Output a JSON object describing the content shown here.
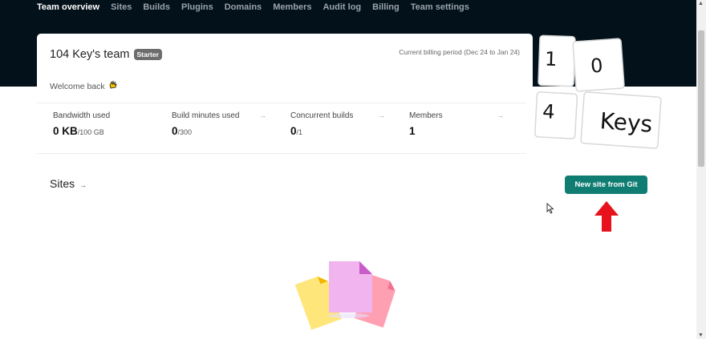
{
  "nav": {
    "items": [
      {
        "label": "Team overview",
        "active": true
      },
      {
        "label": "Sites",
        "active": false
      },
      {
        "label": "Builds",
        "active": false
      },
      {
        "label": "Plugins",
        "active": false
      },
      {
        "label": "Domains",
        "active": false
      },
      {
        "label": "Members",
        "active": false
      },
      {
        "label": "Audit log",
        "active": false
      },
      {
        "label": "Billing",
        "active": false
      },
      {
        "label": "Team settings",
        "active": false
      }
    ]
  },
  "team": {
    "name": "104 Key's team",
    "plan_badge": "Starter",
    "billing_period": "Current billing period (Dec 24 to Jan 24)",
    "welcome": "Welcome back",
    "welcome_icon": "waving-hand-icon"
  },
  "stats": [
    {
      "label": "Bandwidth used",
      "value": "0 KB",
      "limit": "/100 GB",
      "has_arrow": false
    },
    {
      "label": "Build minutes used",
      "value": "0",
      "limit": "/300",
      "has_arrow": true
    },
    {
      "label": "Concurrent builds",
      "value": "0",
      "limit": "/1",
      "has_arrow": true
    },
    {
      "label": "Members",
      "value": "1",
      "limit": "",
      "has_arrow": true
    }
  ],
  "stat_arrow": "→",
  "logo": {
    "keys": [
      "1",
      "0",
      "4",
      "Keys"
    ]
  },
  "sites": {
    "title": "Sites",
    "title_arrow": "→",
    "new_site_button": "New site from Git"
  },
  "colors": {
    "header_bg": "#03111a",
    "primary_button": "#107d73",
    "annotation_arrow": "#e8121c"
  }
}
